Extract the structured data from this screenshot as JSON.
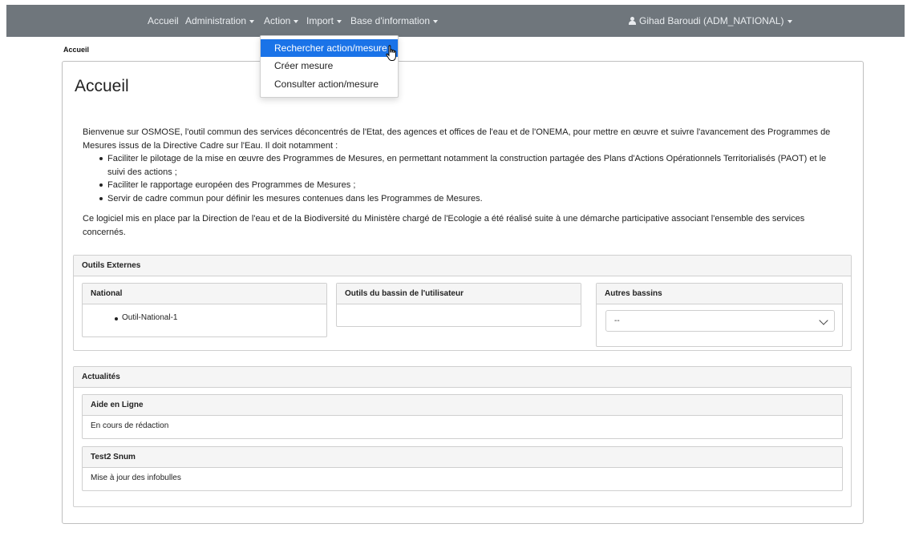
{
  "nav": {
    "home": "Accueil",
    "admin": "Administration",
    "action": "Action",
    "import": "Import",
    "info": "Base d'information",
    "user": "Gihad Baroudi (ADM_NATIONAL)"
  },
  "dropdown": {
    "items": [
      "Rechercher action/mesure",
      "Créer mesure",
      "Consulter action/mesure"
    ],
    "active_index": 0
  },
  "breadcrumb": "Accueil",
  "page": {
    "title": "Accueil",
    "intro_p1": "Bienvenue sur OSMOSE, l'outil commun des services déconcentrés de l'Etat, des agences et offices de l'eau et de l'ONEMA, pour mettre en œuvre et suivre l'avancement des Programmes de Mesures issus de la Directive Cadre sur l'Eau. Il doit notamment :",
    "bullets": [
      "Faciliter le pilotage de la mise en œuvre des Programmes de Mesures, en permettant notamment la construction partagée des Plans d'Actions Opérationnels Territorialisés (PAOT) et le suivi des actions ;",
      "Faciliter le rapportage européen des Programmes de Mesures ;",
      "Servir de cadre commun pour définir les mesures contenues dans les Programmes de Mesures."
    ],
    "intro_p2": "Ce logiciel mis en place par la Direction de l'eau et de la Biodiversité du Ministère chargé de l'Ecologie a été réalisé suite à une démarche participative associant l'ensemble des services concernés."
  },
  "outils": {
    "title": "Outils Externes",
    "national": {
      "title": "National",
      "items": [
        "Outil-National-1"
      ]
    },
    "bassin": {
      "title": "Outils du bassin de l'utilisateur"
    },
    "autres": {
      "title": "Autres bassins",
      "select_value": "--"
    }
  },
  "actualites": {
    "title": "Actualités",
    "items": [
      {
        "title": "Aide en Ligne",
        "body": "En cours de rédaction"
      },
      {
        "title": "Test2 Snum",
        "body": "Mise à jour des infobulles"
      }
    ]
  },
  "colors": {
    "navbar": "#6f767c",
    "active_item": "#1a73e8"
  },
  "icons": {
    "user": "user-icon",
    "caret": "caret-down-icon",
    "select": "chevron-down-icon",
    "cursor": "hand-pointer-icon"
  }
}
